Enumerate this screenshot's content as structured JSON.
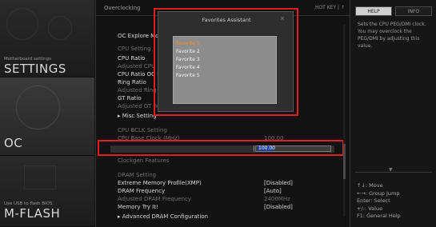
{
  "sidebar": {
    "settings_caption": "Motherboard settings",
    "settings_label": "SETTINGS",
    "oc_label": "OC",
    "mflash_caption": "Use USB to flash BIOS",
    "mflash_label": "M-FLASH"
  },
  "main": {
    "section_title": "Overclocking",
    "hotkey": "HOT KEY | ↑",
    "rows": [
      {
        "label": "OC Explore Mode",
        "value": "",
        "dim": false
      },
      {
        "label": "CPU Setting",
        "value": "",
        "dim": true
      },
      {
        "label": "CPU Ratio",
        "value": "",
        "dim": false
      },
      {
        "label": "Adjusted CPU Frequency",
        "value": "",
        "dim": true
      },
      {
        "label": "CPU Ratio OC Mode",
        "value": "",
        "dim": false
      },
      {
        "label": "Ring Ratio",
        "value": "",
        "dim": false
      },
      {
        "label": "Adjusted Ring Frequency",
        "value": "",
        "dim": true
      },
      {
        "label": "GT Ratio",
        "value": "",
        "dim": false
      },
      {
        "label": "Adjusted GT Frequency",
        "value": "",
        "dim": true
      },
      {
        "label": "▸ Misc Setting",
        "value": "",
        "dim": false
      },
      {
        "label": "CPU BCLK Setting",
        "value": "",
        "dim": true
      },
      {
        "label": "CPU Base Clock (MHz)",
        "value": "100.00",
        "dim": true
      },
      {
        "label": "CPU PEG/DMI Clock (MHz)",
        "value": "100.00",
        "dim": false
      },
      {
        "label": "Clockgen Features",
        "value": "",
        "dim": true
      },
      {
        "label": "DRAM Setting",
        "value": "",
        "dim": true
      },
      {
        "label": "Extreme Memory Profile(XMP)",
        "value": "[Disabled]",
        "dim": false
      },
      {
        "label": "DRAM Frequency",
        "value": "[Auto]",
        "dim": false
      },
      {
        "label": "Adjusted DRAM Frequency",
        "value": "2400MHz",
        "dim": true
      },
      {
        "label": "Memory Try It!",
        "value": "[Disabled]",
        "dim": false
      },
      {
        "label": "▸ Advanced DRAM Configuration",
        "value": "",
        "dim": false
      }
    ],
    "edit_value": "100.00"
  },
  "favorites": {
    "title": "Favorites Assistant",
    "close": "×",
    "items": [
      "Favorite 1",
      "Favorite 2",
      "Favorite 3",
      "Favorite 4",
      "Favorite 5"
    ],
    "selected_index": 0
  },
  "help": {
    "tab_help": "HELP",
    "tab_info": "INFO",
    "text": "Sets the CPU PEG/DMI clock. You may overclock the PEG/DMI by adjusting this value.",
    "keys": [
      "↑↓: Move",
      "←→: Group Jump",
      "Enter: Select",
      "+/-: Value",
      "F1: General Help"
    ]
  },
  "colors": {
    "highlight": "#e31d1d",
    "selected_favorite": "#ff8a1f",
    "edit_selection": "#1f3fa6"
  }
}
